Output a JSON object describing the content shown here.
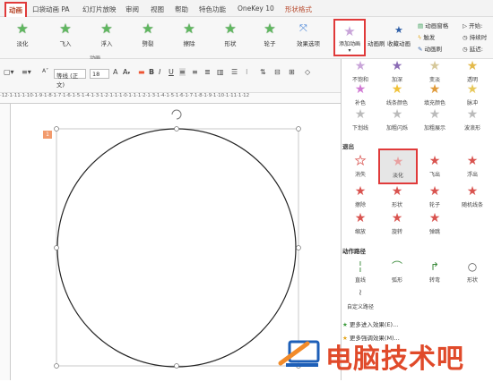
{
  "tabs": [
    "动画",
    "口袋动画 PA",
    "幻灯片放映",
    "审阅",
    "视图",
    "帮助",
    "特色功能",
    "OneKey 10",
    "形状格式"
  ],
  "ribbon": {
    "effects": [
      "淡化",
      "飞入",
      "浮入",
      "劈裂",
      "擦除",
      "形状",
      "轮子"
    ],
    "effect_options": "效果选项",
    "add_animation": "添加动画",
    "anim_painter": "动画刷",
    "fav_anim": "收藏动画",
    "anim_pane": "动画窗格",
    "trigger": "触发",
    "start": "开始:",
    "duration": "持续时",
    "delay": "延迟:",
    "group_label": "动画"
  },
  "fontbar": {
    "font": "等线 (正文)",
    "size": "18"
  },
  "ruler_text": "·12·1·11·1·10·1·9·1·8·1·7·1·6·1·5·1·4·1·3·1·2·1·1·1·0·1·1·1·2·1·3·1·4·1·5·1·6·1·7·1·8·1·9·1·10·1·11·1·12",
  "slide_number": "1",
  "panel": {
    "row0": [
      "不饱和",
      "加深",
      "变淡",
      "透明"
    ],
    "row1": [
      "补色",
      "线条颜色",
      "填充颜色",
      "脉冲"
    ],
    "row2": [
      "下划线",
      "加粗闪烁",
      "加粗展示",
      "波浪形"
    ],
    "exit_title": "退出",
    "exit_row0": [
      "消失",
      "淡化",
      "飞出",
      "浮出"
    ],
    "exit_row1": [
      "擦除",
      "形状",
      "轮子",
      "随机线条"
    ],
    "exit_row2": [
      "缩放",
      "旋转",
      "弹跳",
      ""
    ],
    "path_title": "动作路径",
    "paths": [
      "直线",
      "弧形",
      "转弯",
      "形状"
    ],
    "custom_path": "自定义路径",
    "menu": [
      "更多进入效果(E)...",
      "更多强调效果(M)..."
    ]
  },
  "watermark": "电脑技术吧",
  "colors": {
    "accent_red": "#e03a3a",
    "star_green": "#5fb75f",
    "star_red": "#d9534f",
    "watermark": "#e04a2a"
  }
}
